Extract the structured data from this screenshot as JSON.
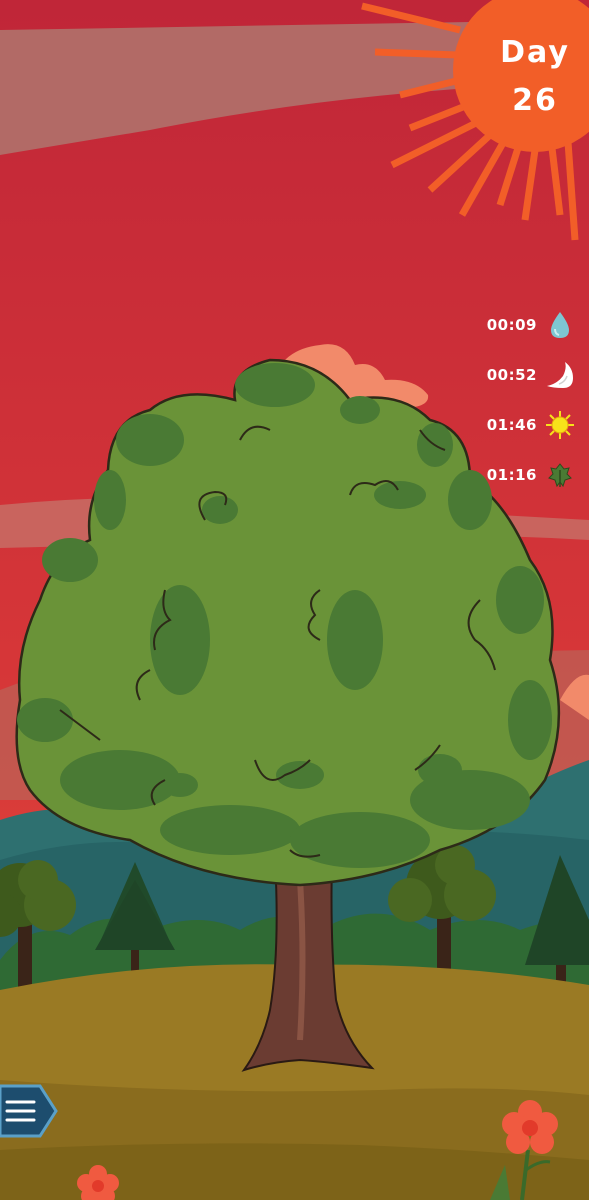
{
  "hud": {
    "day_label": "Day",
    "day_number": "26"
  },
  "timers": [
    {
      "value": "00:09",
      "icon": "water-drop-icon"
    },
    {
      "value": "00:52",
      "icon": "snail-shell-icon"
    },
    {
      "value": "01:46",
      "icon": "sun-icon"
    },
    {
      "value": "01:16",
      "icon": "leaf-icon"
    }
  ],
  "menu": {
    "icon": "hamburger-menu-icon"
  },
  "colors": {
    "sky": "#c4283a",
    "sun": "#f25e28",
    "foliage": "#6a9338",
    "trunk": "#6b3c32",
    "ground": "#9a7a24"
  }
}
